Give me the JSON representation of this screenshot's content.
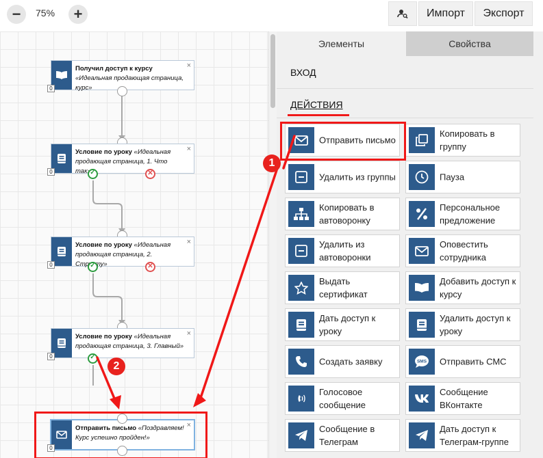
{
  "toolbar": {
    "zoom_out_label": "−",
    "zoom_value": "75%",
    "zoom_in_label": "+",
    "import_label": "Импорт",
    "export_label": "Экспорт",
    "person_search_icon": "person-search-icon"
  },
  "canvas": {
    "nodes": [
      {
        "title": "Получил доступ к курсу",
        "subtitle": "«Идеальная продающая страница, курс»",
        "icon": "book-open-icon",
        "counter": "0"
      },
      {
        "title": "Условие по уроку",
        "subtitle": "«Идеальная продающая страница, 1. Что так»",
        "icon": "lesson-icon",
        "counter": "0"
      },
      {
        "title": "Условие по уроку",
        "subtitle": "«Идеальная продающая страница, 2. Структу»",
        "icon": "lesson-icon",
        "counter": "0"
      },
      {
        "title": "Условие по уроку",
        "subtitle": "«Идеальная продающая страница, 3. Главный»",
        "icon": "lesson-icon",
        "counter": "0"
      },
      {
        "title": "Отправить письмо",
        "subtitle": "«Поздравляем! Курс успешно пройден!»",
        "icon": "envelope-icon",
        "counter": "0"
      }
    ],
    "close_glyph": "×",
    "ok_glyph": "✓",
    "no_glyph": "✕"
  },
  "panel": {
    "tabs": [
      {
        "label": "Элементы",
        "active": true
      },
      {
        "label": "Свойства",
        "active": false
      }
    ],
    "sections": {
      "entry": "ВХОД",
      "actions": "ДЕЙСТВИЯ"
    },
    "actions": [
      {
        "label": "Отправить письмо",
        "icon": "envelope-icon"
      },
      {
        "label": "Копировать в группу",
        "icon": "copy-icon"
      },
      {
        "label": "Удалить из группы",
        "icon": "minus-box-icon"
      },
      {
        "label": "Пауза",
        "icon": "clock-icon"
      },
      {
        "label": "Копировать в автоворонку",
        "icon": "sitemap-icon"
      },
      {
        "label": "Персональное предложение",
        "icon": "percent-icon"
      },
      {
        "label": "Удалить из автоворонки",
        "icon": "minus-box-icon"
      },
      {
        "label": "Оповестить сотрудника",
        "icon": "envelope-icon"
      },
      {
        "label": "Выдать сертификат",
        "icon": "star-icon"
      },
      {
        "label": "Добавить доступ к курсу",
        "icon": "book-open-icon"
      },
      {
        "label": "Дать доступ к уроку",
        "icon": "lesson-icon"
      },
      {
        "label": "Удалить доступ к уроку",
        "icon": "lesson-icon"
      },
      {
        "label": "Создать заявку",
        "icon": "phone-icon"
      },
      {
        "label": "Отправить СМС",
        "icon": "sms-icon"
      },
      {
        "label": "Голосовое сообщение",
        "icon": "phone-volume-icon"
      },
      {
        "label": "Сообщение ВКонтакте",
        "icon": "vk-icon"
      },
      {
        "label": "Сообщение в Телеграм",
        "icon": "telegram-icon"
      },
      {
        "label": "Дать доступ к Телеграм-группе",
        "icon": "telegram-icon"
      }
    ]
  },
  "annotations": {
    "badge1": "1",
    "badge2": "2",
    "accent_color": "#f01818",
    "icon_bg": "#2d5b8c"
  }
}
